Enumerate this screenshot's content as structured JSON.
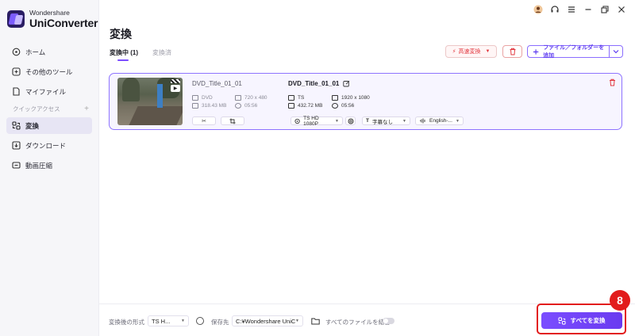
{
  "app": {
    "brand": "Wondershare",
    "product": "UniConverter"
  },
  "sidebar": {
    "items": [
      {
        "label": "ホーム",
        "icon": "home-icon"
      },
      {
        "label": "その他のツール",
        "icon": "tools-icon"
      },
      {
        "label": "マイファイル",
        "icon": "file-icon"
      }
    ],
    "section_label": "クイックアクセス",
    "section_add": "+",
    "quick_items": [
      {
        "label": "変換",
        "icon": "convert-icon",
        "active": true
      },
      {
        "label": "ダウンロード",
        "icon": "download-icon"
      },
      {
        "label": "動画圧縮",
        "icon": "compress-icon"
      }
    ]
  },
  "header": {
    "title": "変換",
    "tabs": [
      {
        "label": "変換中",
        "count": "(1)"
      },
      {
        "label": "変換済"
      }
    ],
    "fast_convert": "高速変換",
    "add_file": "ファイル／フォルダーを追加"
  },
  "file": {
    "source": {
      "title": "DVD_Title_01_01",
      "format": "DVD",
      "resolution": "720 x 480",
      "size": "318.43 MB",
      "duration": "05:56"
    },
    "target": {
      "title": "DVD_Title_01_01",
      "format": "TS",
      "resolution": "1920 x 1080",
      "size": "432.72 MB",
      "duration": "05:56",
      "preset": "TS HD 1080P",
      "subtitle": "字幕なし",
      "audio": "English-..."
    }
  },
  "bottom": {
    "output_format_label": "変換後の形式",
    "output_format_value": "TS H...",
    "save_to_label": "保存先",
    "save_to_value": "C:¥Wondershare UniCor",
    "merge_label": "すべてのファイルを結合",
    "merge_enabled": false,
    "convert_all": "すべてを変換"
  },
  "annotation": {
    "step": "8"
  },
  "colors": {
    "accent": "#7b4dff",
    "danger": "#e2373f",
    "callout": "#e21c1c"
  }
}
